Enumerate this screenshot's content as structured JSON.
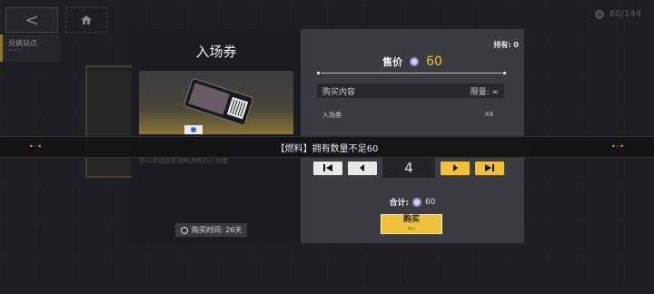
{
  "topbar": {
    "back_icon": "<",
    "currency_value": "60/144"
  },
  "sidebar": {
    "tab_label": "兑换站点",
    "tab_sub": "•••••"
  },
  "item": {
    "title": "入场券",
    "description": "供以活动副本消耗消耗的入场券",
    "buy_time": "购买时间: 26天"
  },
  "shop": {
    "owned": "持有: 0",
    "price_label": "售价",
    "price_value": "60",
    "content_header": "购买内容",
    "limit_header": "限量: ∞",
    "content_item": "入场券",
    "content_count": "X4",
    "quantity": "4",
    "total_label": "合计:",
    "total_value": "60",
    "buy_label": "购买",
    "buy_sub": "Buy"
  },
  "notice": {
    "text": "【燃料】拥有数量不足60"
  },
  "colors": {
    "accent": "#f0c23c",
    "panel_dark": "#1b1c22",
    "panel_gray": "#3a3c40"
  }
}
